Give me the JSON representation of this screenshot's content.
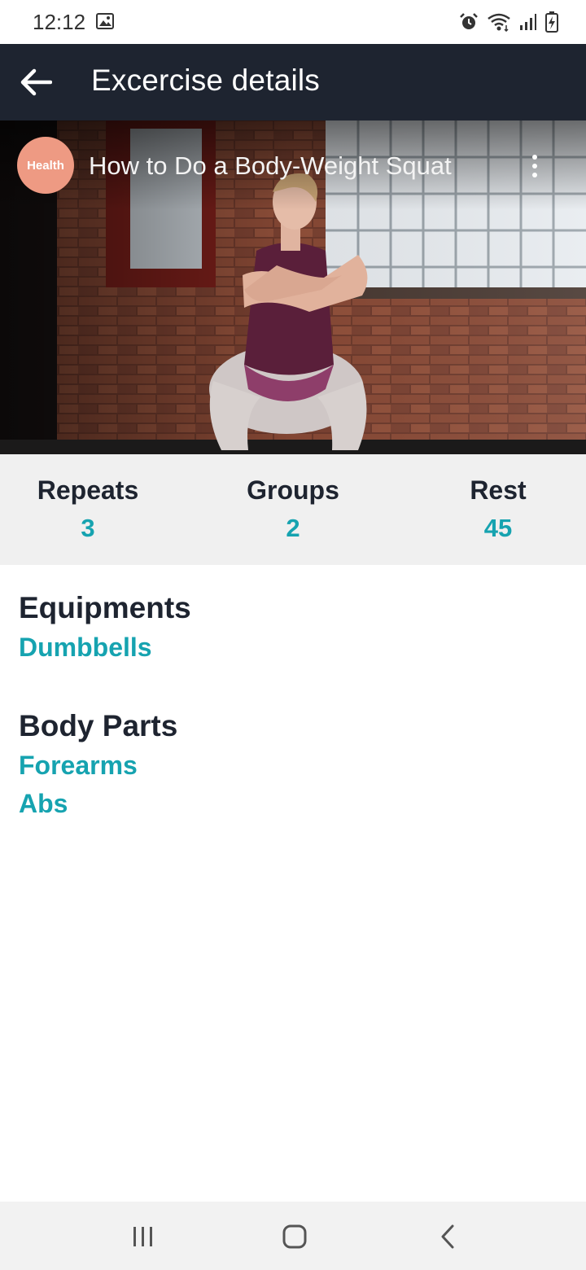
{
  "status_bar": {
    "time": "12:12",
    "icons": [
      "gallery-icon",
      "alarm-icon",
      "wifi-icon",
      "signal-icon",
      "battery-charging-icon"
    ]
  },
  "app_bar": {
    "title": "Excercise details",
    "back_icon": "arrow-left-icon"
  },
  "video": {
    "channel": "Health",
    "channel_color": "#ee9a83",
    "title": "How to Do a Body-Weight Squat",
    "more_icon": "more-vertical-icon"
  },
  "stats": {
    "repeats": {
      "label": "Repeats",
      "value": "3"
    },
    "groups": {
      "label": "Groups",
      "value": "2"
    },
    "rest": {
      "label": "Rest",
      "value": "45"
    }
  },
  "equipments": {
    "heading": "Equipments",
    "items": [
      "Dumbbells"
    ]
  },
  "body_parts": {
    "heading": "Body Parts",
    "items": [
      "Forearms",
      "Abs"
    ]
  },
  "colors": {
    "app_bar": "#1e2430",
    "accent": "#16a3b0",
    "heading_text": "#1e2430",
    "stats_background": "#f0f0f0"
  },
  "nav_bar": {
    "icons": [
      "recents-icon",
      "home-icon",
      "back-icon"
    ]
  }
}
